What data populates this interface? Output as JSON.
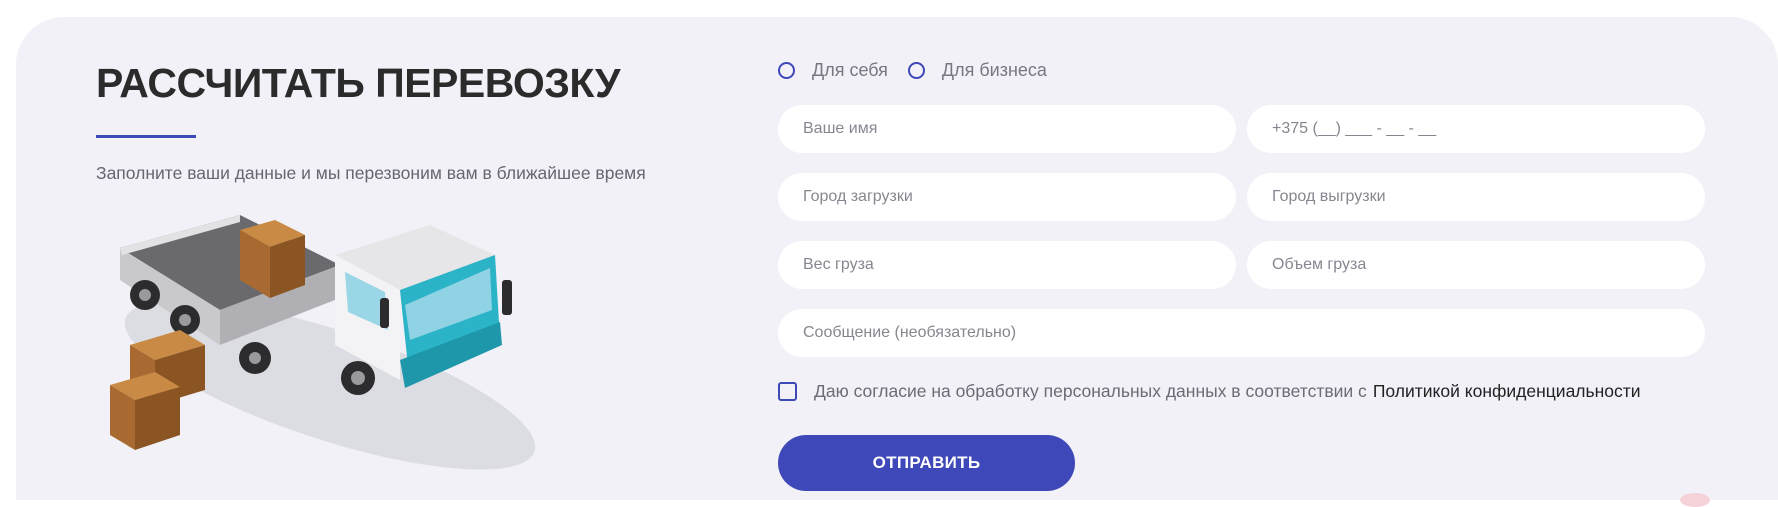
{
  "section": {
    "title": "РАССЧИТАТЬ ПЕРЕВОЗКУ",
    "subtitle": "Заполните ваши данные и мы перезвоним вам в ближайшее время"
  },
  "form": {
    "radios": [
      {
        "label": "Для себя",
        "checked": false
      },
      {
        "label": "Для бизнеса",
        "checked": false
      }
    ],
    "fields": {
      "name_placeholder": "Ваше имя",
      "phone_placeholder": "+375 (__) ___ - __ - __",
      "from_city_placeholder": "Город загрузки",
      "to_city_placeholder": "Город выгрузки",
      "weight_placeholder": "Вес груза",
      "volume_placeholder": "Объем груза",
      "message_placeholder": "Сообщение (необязательно)"
    },
    "consent": {
      "checked": false,
      "text": "Даю согласие на обработку персональных данных в соответствии с",
      "link": "Политикой конфиденциальности"
    },
    "submit_label": "ОТПРАВИТЬ"
  },
  "colors": {
    "accent": "#3f48b8",
    "card_background": "#f1f1f7",
    "title": "#2b2b2b",
    "truck_teal": "#2bb3c8"
  },
  "illustration": {
    "icon": "truck-with-boxes-icon"
  }
}
